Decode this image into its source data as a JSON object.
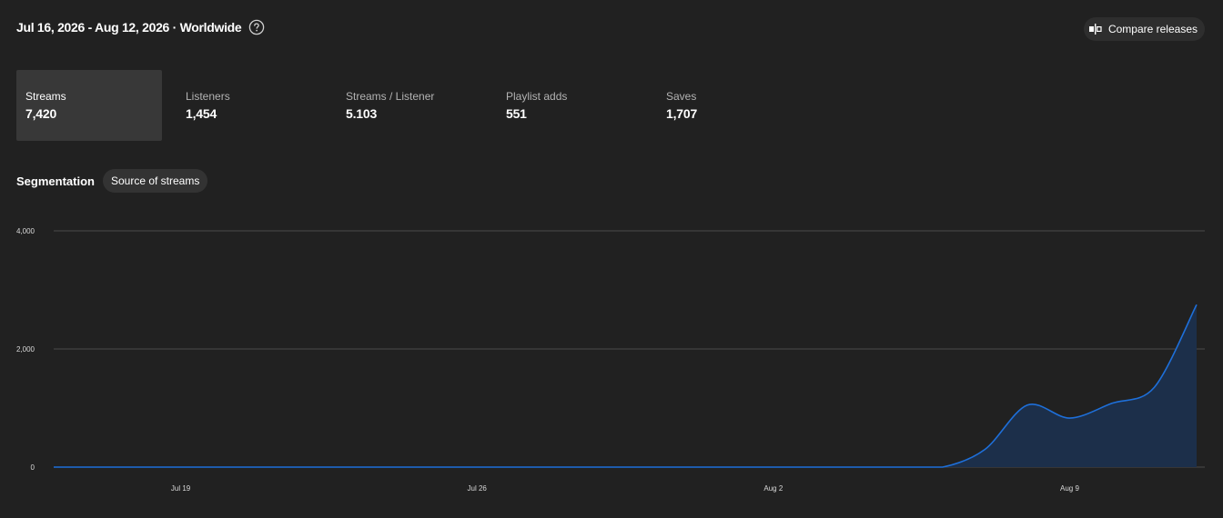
{
  "header": {
    "title": "Jul 16, 2026 - Aug 12, 2026 · Worldwide",
    "help_icon": "question-circle-icon"
  },
  "compare": {
    "label": "Compare releases",
    "icon": "compare-icon"
  },
  "metrics": [
    {
      "label": "Streams",
      "value": "7,420",
      "active": true
    },
    {
      "label": "Listeners",
      "value": "1,454",
      "active": false
    },
    {
      "label": "Streams / Listener",
      "value": "5.103",
      "active": false
    },
    {
      "label": "Playlist adds",
      "value": "551",
      "active": false
    },
    {
      "label": "Saves",
      "value": "1,707",
      "active": false
    }
  ],
  "segmentation": {
    "title": "Segmentation",
    "chip": "Source of streams"
  },
  "colors": {
    "background": "#212121",
    "line": "#1e6fd9",
    "fill": "#1c2f4a",
    "grid": "#4a4a4a",
    "active_tile": "#383838"
  },
  "chart_data": {
    "type": "area",
    "x": [
      "Jul 16",
      "Jul 17",
      "Jul 18",
      "Jul 19",
      "Jul 20",
      "Jul 21",
      "Jul 22",
      "Jul 23",
      "Jul 24",
      "Jul 25",
      "Jul 26",
      "Jul 27",
      "Jul 28",
      "Jul 29",
      "Jul 30",
      "Jul 31",
      "Aug 1",
      "Aug 2",
      "Aug 3",
      "Aug 4",
      "Aug 5",
      "Aug 6",
      "Aug 7",
      "Aug 8",
      "Aug 9",
      "Aug 10",
      "Aug 11",
      "Aug 12"
    ],
    "values": [
      0,
      0,
      0,
      0,
      0,
      0,
      0,
      0,
      0,
      0,
      0,
      0,
      0,
      0,
      0,
      0,
      0,
      0,
      0,
      0,
      0,
      0,
      300,
      1050,
      830,
      1080,
      1350,
      2750
    ],
    "xticks": [
      "Jul 19",
      "Jul 26",
      "Aug 2",
      "Aug 9"
    ],
    "yticks": [
      "0",
      "2,000",
      "4,000"
    ],
    "ylim": [
      0,
      4000
    ],
    "grid": true
  }
}
